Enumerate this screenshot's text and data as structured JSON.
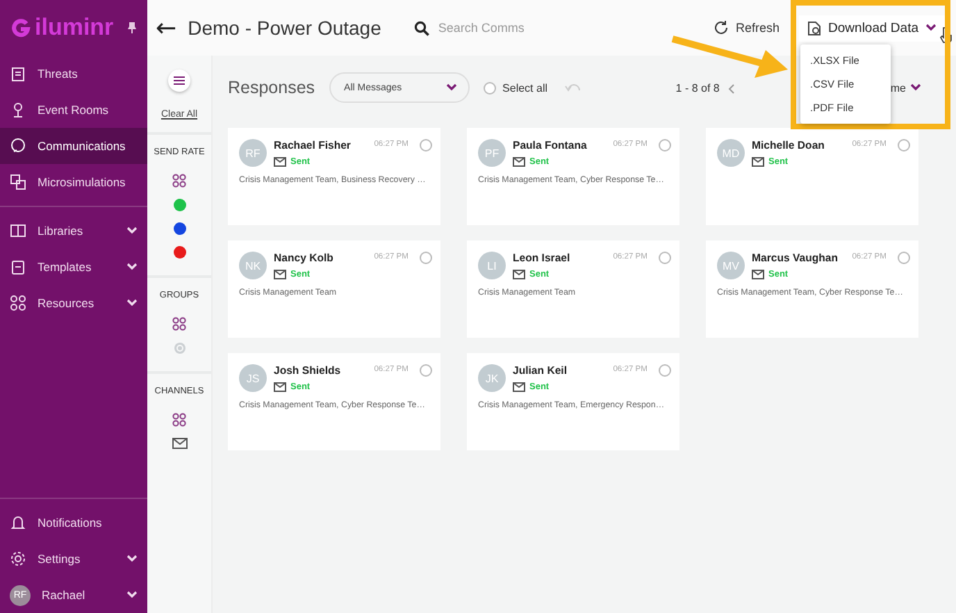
{
  "sidebar": {
    "brand": "iluminr",
    "items": [
      {
        "label": "Threats",
        "selected": false,
        "expandable": false
      },
      {
        "label": "Event Rooms",
        "selected": false,
        "expandable": false
      },
      {
        "label": "Communications",
        "selected": true,
        "expandable": false
      },
      {
        "label": "Microsimulations",
        "selected": false,
        "expandable": false
      },
      {
        "label": "Libraries",
        "selected": false,
        "expandable": true
      },
      {
        "label": "Templates",
        "selected": false,
        "expandable": true
      },
      {
        "label": "Resources",
        "selected": false,
        "expandable": true
      }
    ],
    "bottom_items": [
      {
        "label": "Notifications",
        "expandable": false
      },
      {
        "label": "Settings",
        "expandable": true
      }
    ],
    "user": {
      "initials": "RF",
      "name": "Rachael"
    }
  },
  "header": {
    "back": "←",
    "title": "Demo - Power Outage",
    "search": {
      "placeholder": "Search Comms"
    },
    "refresh": "Refresh",
    "download": "Download Data"
  },
  "download_menu": [
    ".XLSX File",
    ".CSV File",
    ".PDF File"
  ],
  "filters": {
    "clear": "Clear All",
    "sections": [
      {
        "title": "SEND RATE",
        "options": [
          {
            "kind": "all"
          },
          {
            "kind": "dot",
            "color": "#1ec24a"
          },
          {
            "kind": "dot",
            "color": "#1446e0"
          },
          {
            "kind": "dot",
            "color": "#e81b1b"
          }
        ]
      },
      {
        "title": "GROUPS",
        "options": [
          {
            "kind": "all"
          },
          {
            "kind": "circle"
          }
        ]
      },
      {
        "title": "CHANNELS",
        "options": [
          {
            "kind": "all"
          },
          {
            "kind": "mail"
          }
        ]
      }
    ]
  },
  "toolbar": {
    "title": "Responses",
    "filter": "All Messages",
    "select_all": {
      "label": "Select all",
      "checked": false
    },
    "pagination": "1 - 8 of 8",
    "sort": "me"
  },
  "responses": [
    {
      "initials": "RF",
      "name": "Rachael Fisher",
      "time": "06:27 PM",
      "status": "Sent",
      "groups": "Crisis Management Team, Business Recovery …",
      "checked": false
    },
    {
      "initials": "PF",
      "name": "Paula Fontana",
      "time": "06:27 PM",
      "status": "Sent",
      "groups": "Crisis Management Team, Cyber Response Te…",
      "checked": false
    },
    {
      "initials": "MD",
      "name": "Michelle Doan",
      "time": "06:27 PM",
      "status": "Sent",
      "checked": false
    },
    {
      "initials": "NK",
      "name": "Nancy Kolb",
      "time": "06:27 PM",
      "status": "Sent",
      "groups": "Crisis Management Team",
      "checked": false
    },
    {
      "initials": "LI",
      "name": "Leon Israel",
      "time": "06:27 PM",
      "status": "Sent",
      "groups": "Crisis Management Team",
      "checked": false
    },
    {
      "initials": "MV",
      "name": "Marcus Vaughan",
      "time": "06:27 PM",
      "status": "Sent",
      "groups": "Crisis Management Team, Cyber Response Te…",
      "checked": false
    },
    {
      "initials": "JS",
      "name": "Josh Shields",
      "time": "06:27 PM",
      "status": "Sent",
      "groups": "Crisis Management Team, Cyber Response Te…",
      "checked": false
    },
    {
      "initials": "JK",
      "name": "Julian Keil",
      "time": "06:27 PM",
      "status": "Sent",
      "groups": "Crisis Management Team, Emergency Respon…",
      "checked": false
    }
  ]
}
